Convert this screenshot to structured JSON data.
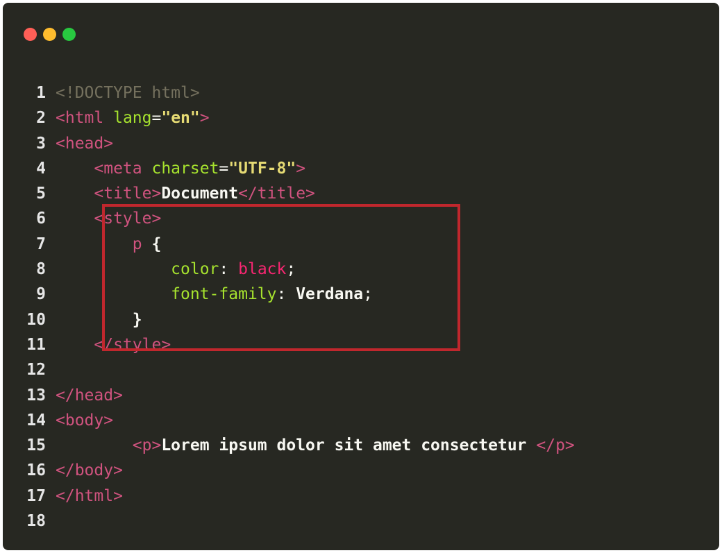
{
  "window": {
    "traffic_lights": [
      {
        "name": "close",
        "color": "#ff5f57"
      },
      {
        "name": "minimize",
        "color": "#febc2e"
      },
      {
        "name": "zoom",
        "color": "#28c840"
      }
    ]
  },
  "colors": {
    "background": "#272822",
    "tag": "#d0537f",
    "attribute": "#a6e22e",
    "string": "#e6db74",
    "keyword_value": "#f92672",
    "highlight_border": "#c0272d"
  },
  "lines": [
    {
      "number": "1",
      "tokens": [
        {
          "t": "<!DOCTYPE html>",
          "c": "doctype"
        }
      ]
    },
    {
      "number": "2",
      "tokens": [
        {
          "t": "<html ",
          "c": "tag"
        },
        {
          "t": "lang",
          "c": "attr"
        },
        {
          "t": "=",
          "c": "punct"
        },
        {
          "t": "\"en\"",
          "c": "str"
        },
        {
          "t": ">",
          "c": "tag"
        }
      ]
    },
    {
      "number": "3",
      "tokens": [
        {
          "t": "<head>",
          "c": "tag"
        }
      ]
    },
    {
      "number": "4",
      "tokens": [
        {
          "t": "    ",
          "c": "punct"
        },
        {
          "t": "<meta ",
          "c": "tag"
        },
        {
          "t": "charset",
          "c": "attr"
        },
        {
          "t": "=",
          "c": "punct"
        },
        {
          "t": "\"UTF-8\"",
          "c": "str"
        },
        {
          "t": ">",
          "c": "tag"
        }
      ]
    },
    {
      "number": "5",
      "tokens": [
        {
          "t": "    ",
          "c": "punct"
        },
        {
          "t": "<title>",
          "c": "tag"
        },
        {
          "t": "Document",
          "c": "text"
        },
        {
          "t": "</title>",
          "c": "tag"
        }
      ]
    },
    {
      "number": "6",
      "tokens": [
        {
          "t": "    ",
          "c": "punct"
        },
        {
          "t": "<style>",
          "c": "tag"
        }
      ]
    },
    {
      "number": "7",
      "tokens": [
        {
          "t": "        ",
          "c": "punct"
        },
        {
          "t": "p ",
          "c": "sel"
        },
        {
          "t": "{",
          "c": "bracew"
        }
      ]
    },
    {
      "number": "8",
      "tokens": [
        {
          "t": "            ",
          "c": "punct"
        },
        {
          "t": "color",
          "c": "prop"
        },
        {
          "t": ": ",
          "c": "punct"
        },
        {
          "t": "black",
          "c": "val-red"
        },
        {
          "t": ";",
          "c": "punct"
        }
      ]
    },
    {
      "number": "9",
      "tokens": [
        {
          "t": "            ",
          "c": "punct"
        },
        {
          "t": "font-family",
          "c": "prop"
        },
        {
          "t": ": ",
          "c": "punct"
        },
        {
          "t": "Verdana",
          "c": "val-white"
        },
        {
          "t": ";",
          "c": "punct"
        }
      ]
    },
    {
      "number": "10",
      "tokens": [
        {
          "t": "        ",
          "c": "punct"
        },
        {
          "t": "}",
          "c": "bracew"
        }
      ]
    },
    {
      "number": "11",
      "tokens": [
        {
          "t": "    ",
          "c": "punct"
        },
        {
          "t": "</style>",
          "c": "tag"
        }
      ]
    },
    {
      "number": "12",
      "tokens": []
    },
    {
      "number": "13",
      "tokens": [
        {
          "t": "</head>",
          "c": "tag"
        }
      ]
    },
    {
      "number": "14",
      "tokens": [
        {
          "t": "<body>",
          "c": "tag"
        }
      ]
    },
    {
      "number": "15",
      "tokens": [
        {
          "t": "        ",
          "c": "punct"
        },
        {
          "t": "<p>",
          "c": "tag"
        },
        {
          "t": "Lorem ipsum dolor sit amet consectetur ",
          "c": "text"
        },
        {
          "t": "</p>",
          "c": "tag"
        }
      ]
    },
    {
      "number": "16",
      "tokens": [
        {
          "t": "</body>",
          "c": "tag"
        }
      ]
    },
    {
      "number": "17",
      "tokens": [
        {
          "t": "</html>",
          "c": "tag"
        }
      ]
    },
    {
      "number": "18",
      "tokens": []
    }
  ]
}
